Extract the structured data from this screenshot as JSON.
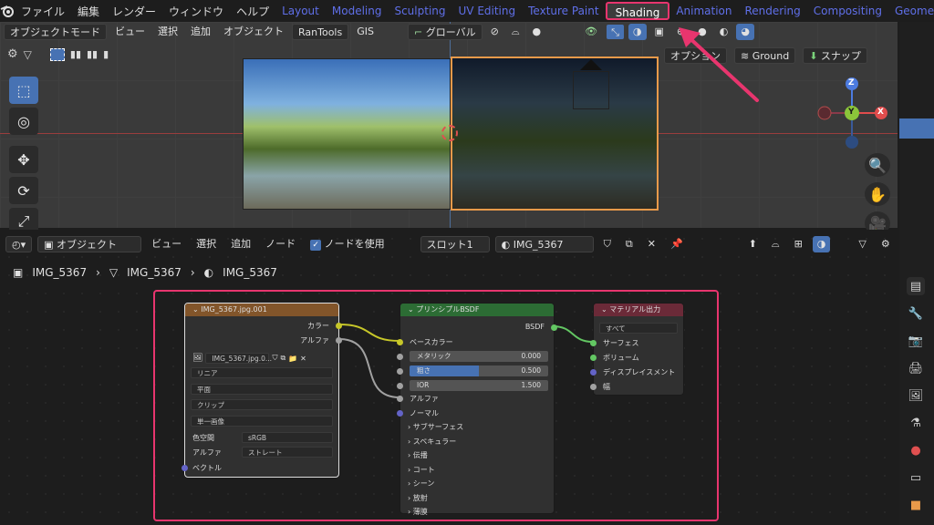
{
  "app": {
    "logo": "blender-logo"
  },
  "menu": [
    "ファイル",
    "編集",
    "レンダー",
    "ウィンドウ",
    "ヘルプ"
  ],
  "workspaces": [
    "Layout",
    "Modeling",
    "Sculpting",
    "UV Editing",
    "Texture Paint",
    "Shading",
    "Animation",
    "Rendering",
    "Compositing",
    "Geomet"
  ],
  "active_workspace": "Shading",
  "viewport": {
    "mode": "オブジェクトモード",
    "menus": [
      "ビュー",
      "選択",
      "追加",
      "オブジェクト"
    ],
    "addon": "RanTools",
    "gis": "GIS",
    "transform": "グローバル",
    "options": "オプション",
    "ground": "Ground",
    "snap": "スナップ",
    "gizmo": {
      "z": "Z",
      "y": "Y",
      "x": "X"
    }
  },
  "node_editor": {
    "type": "オブジェクト",
    "menus": [
      "ビュー",
      "選択",
      "追加",
      "ノード"
    ],
    "use_nodes": "ノードを使用",
    "slot": "スロット1",
    "material": "IMG_5367",
    "breadcrumb": [
      "IMG_5367",
      "IMG_5367",
      "IMG_5367"
    ]
  },
  "image_node": {
    "title": "IMG_5367.jpg.001",
    "out_color": "カラー",
    "out_alpha": "アルファ",
    "image_name": "IMG_5367.jpg.0...",
    "interpolation": "リニア",
    "projection": "平面",
    "extension": "クリップ",
    "source": "単一画像",
    "colorspace_label": "色空間",
    "colorspace": "sRGB",
    "alpha_label": "アルファ",
    "alpha_mode": "ストレート",
    "vector": "ベクトル"
  },
  "bsdf_node": {
    "title": "プリンシプルBSDF",
    "out": "BSDF",
    "base_color": "ベースカラー",
    "metallic": "メタリック",
    "metallic_val": "0.000",
    "roughness": "粗さ",
    "roughness_val": "0.500",
    "roughness_fill": 0.5,
    "ior": "IOR",
    "ior_val": "1.500",
    "alpha": "アルファ",
    "normal": "ノーマル",
    "panels": [
      "サブサーフェス",
      "スペキュラー",
      "伝播",
      "コート",
      "シーン",
      "放射",
      "薄膜"
    ]
  },
  "output_node": {
    "title": "マテリアル出力",
    "target": "すべて",
    "inputs": [
      "サーフェス",
      "ボリューム",
      "ディスプレイスメント",
      "幅"
    ]
  },
  "colors": {
    "accent": "#e8356e",
    "blue": "#4772b3",
    "image_node_header": "#82552a",
    "bsdf_header": "#2c6c34",
    "output_header": "#6b2a38"
  }
}
